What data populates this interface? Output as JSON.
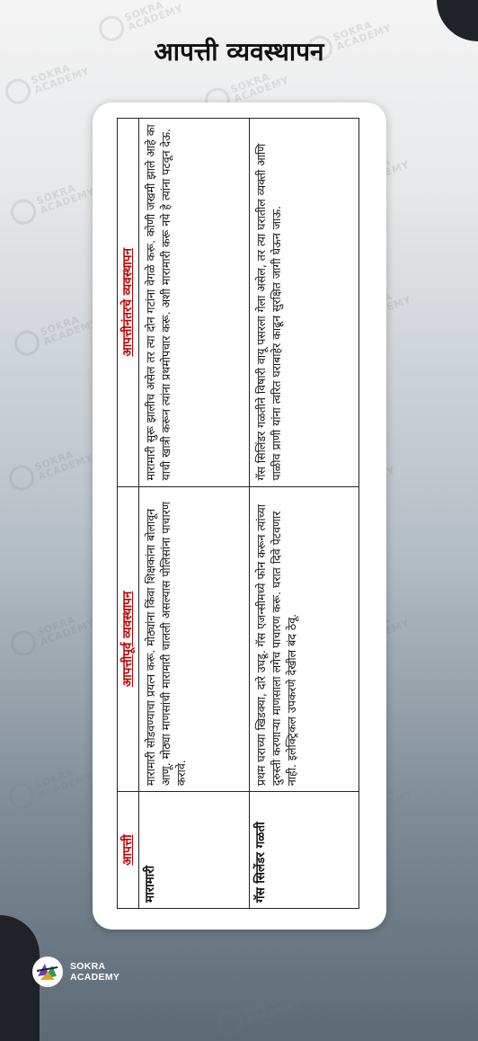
{
  "page": {
    "title": "आपत्ती व्यवस्थापन"
  },
  "table": {
    "headers": [
      "आपत्ती",
      "आपत्तीपूर्व व्यवस्थापन",
      "आपत्तीनंतरचे व्यवस्थापन"
    ],
    "rows": [
      {
        "disaster": "मारामारी",
        "before": "मारामारी सोडवण्याचा प्रयत्न करू. मोठ्यांना किंवा शिक्षकांना बोलावून आणू. मोठ्या माणसांची मारामारी चालली असल्यास पोलिसांना पाचारण करावे.",
        "after": "मारामारी सुरू झालीच असेल तर त्या दोन गटांना वेगळे करू. कोणी जखमी झाले आहे का याची खात्री करून त्यांना प्रथमोपचार करू. अशी मारामारी करू नये हे त्यांना पटवून देऊ."
      },
      {
        "disaster": "गॅस सिलेंडर गळती",
        "before": "प्रथम घराच्या खिडक्या, दारे उघडू. गॅस एजन्सीमध्ये फोन करून त्यांच्या दुरुस्ती करणाऱ्या माणसाला लगेच पाचारण करू. घरात दिवे पेटवणार नाही. इलेक्ट्रिकल उपकरणे देखील बंद ठेवू.",
        "after": "गॅस सिलिंडर गळतीने विषारी वायू पसरला गेला असेल, तर त्या घरातील व्यक्ती आणि पाळीव प्राणी यांना त्वरित घराबाहेर काढून सुरक्षित जागी घेऊन जाऊ."
      }
    ]
  },
  "brand": {
    "line1": "SOKRA",
    "line2": "ACADEMY"
  },
  "watermark": {
    "line1": "SOKRA",
    "line2": "ACADEMY"
  }
}
